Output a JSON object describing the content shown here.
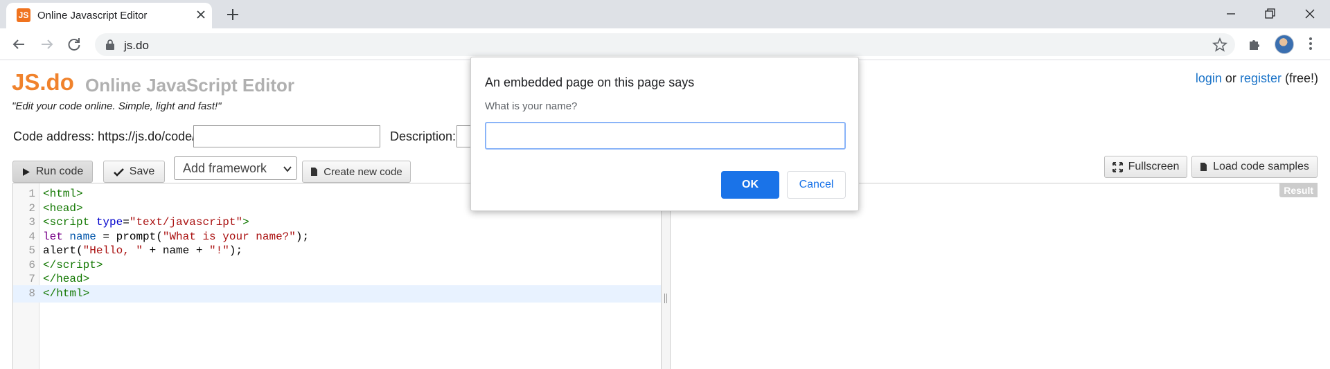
{
  "browser": {
    "tab_title": "Online Javascript Editor",
    "favicon_text": "JS",
    "url": "js.do"
  },
  "header": {
    "logo": "JS.do",
    "site_title": "Online JavaScript Editor",
    "tagline": "\"Edit your code online. Simple, light and fast!\"",
    "login": "login",
    "or": "or",
    "register": "register",
    "free": "(free!)"
  },
  "form": {
    "code_address_label": "Code address: https://js.do/code/",
    "code_address_value": "",
    "description_label": "Description:"
  },
  "toolbar": {
    "run_label": "Run code",
    "save_label": "Save",
    "framework_label": "Add framework",
    "new_code_label": "Create new code",
    "fullscreen_label": "Fullscreen",
    "samples_label": "Load code samples"
  },
  "editor": {
    "lines": [
      {
        "n": "1",
        "html": "<span class=\"tag\">&lt;html&gt;</span>"
      },
      {
        "n": "2",
        "html": "<span class=\"tag\">&lt;head&gt;</span>"
      },
      {
        "n": "3",
        "html": "<span class=\"tag\">&lt;script</span> <span class=\"attr\">type</span>=<span class=\"str\">\"text/javascript\"</span><span class=\"tag\">&gt;</span>"
      },
      {
        "n": "4",
        "html": "<span class=\"kw\">let</span> <span class=\"var\">name</span> = prompt(<span class=\"str\">\"What is your name?\"</span>);"
      },
      {
        "n": "5",
        "html": "alert(<span class=\"str\">\"Hello, \"</span> + name + <span class=\"str\">\"!\"</span>);"
      },
      {
        "n": "6",
        "html": "<span class=\"tag\">&lt;/script&gt;</span>"
      },
      {
        "n": "7",
        "html": "<span class=\"tag\">&lt;/head&gt;</span>"
      },
      {
        "n": "8",
        "html": "<span class=\"tag\">&lt;/html&gt;</span>"
      }
    ],
    "active_line": "8"
  },
  "result": {
    "badge": "Result"
  },
  "dialog": {
    "title": "An embedded page on this page says",
    "message": "What is your name?",
    "input_value": "",
    "ok_label": "OK",
    "cancel_label": "Cancel"
  },
  "colors": {
    "logo": "#f0822c",
    "link": "#1a73c8",
    "dialog_primary": "#1a73e8"
  }
}
